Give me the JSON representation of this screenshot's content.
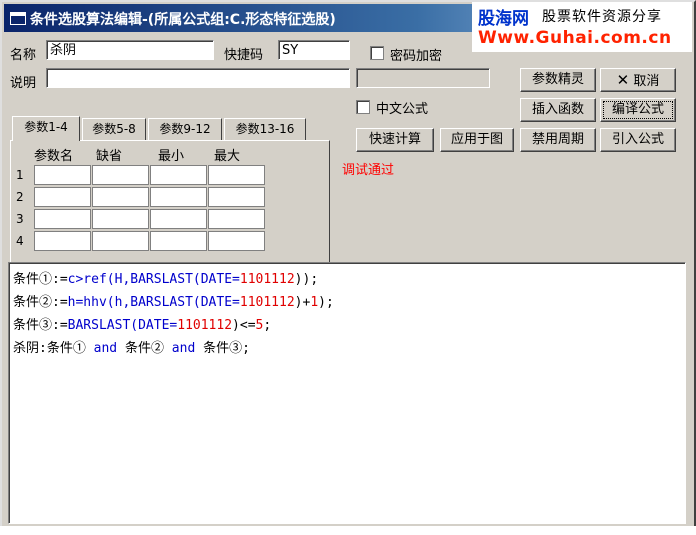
{
  "window": {
    "title": "条件选股算法编辑-(所属公式组:C.形态特征选股)"
  },
  "brand": {
    "logo": "股海网",
    "slogan": "股票软件资源分享",
    "url": "Www.Guhai.com.cn"
  },
  "form": {
    "name_label": "名称",
    "name_value": "杀阴",
    "shortcut_label": "快捷码",
    "shortcut_value": "SY",
    "password_label": "密码加密",
    "desc_label": "说明",
    "desc_value": "",
    "extra_value": "",
    "chinese_formula_label": "中文公式"
  },
  "buttons": {
    "param_wizard": "参数精灵",
    "cancel": "取消",
    "insert_function": "插入函数",
    "compile": "编译公式",
    "quick_calc": "快速计算",
    "apply_chart": "应用于图",
    "disable_period": "禁用周期",
    "import_formula": "引入公式"
  },
  "tabs": [
    "参数1-4",
    "参数5-8",
    "参数9-12",
    "参数13-16"
  ],
  "params": {
    "headers": [
      "参数名",
      "缺省",
      "最小",
      "最大"
    ],
    "rows": [
      "1",
      "2",
      "3",
      "4"
    ]
  },
  "status_text": "调试通过",
  "code": {
    "line1": {
      "a": "条件①:=",
      "b": "c>ref",
      "c": "(H,",
      "d": "BARSLAST",
      "e": "(DATE=",
      "f": "1101112",
      "g": "));"
    },
    "line2": {
      "a": "条件②:=",
      "b": "h=hhv",
      "c": "(h,",
      "d": "BARSLAST",
      "e": "(DATE=",
      "f": "1101112",
      "g": ")+",
      "h": "1",
      "i": ");"
    },
    "line3": {
      "a": "条件③:=",
      "b": "BARSLAST",
      "c": "(DATE=",
      "d": "1101112",
      "e": ")<=",
      "f": "5",
      "g": ";"
    },
    "line4": {
      "a": "杀阴:条件① ",
      "b": "and",
      "c": " 条件② ",
      "d": "and",
      "e": " 条件③;"
    }
  },
  "colors": {
    "keyword": "#0000cc",
    "number": "#e00000",
    "status": "#ff0000",
    "title_bar": "#0a246a"
  }
}
